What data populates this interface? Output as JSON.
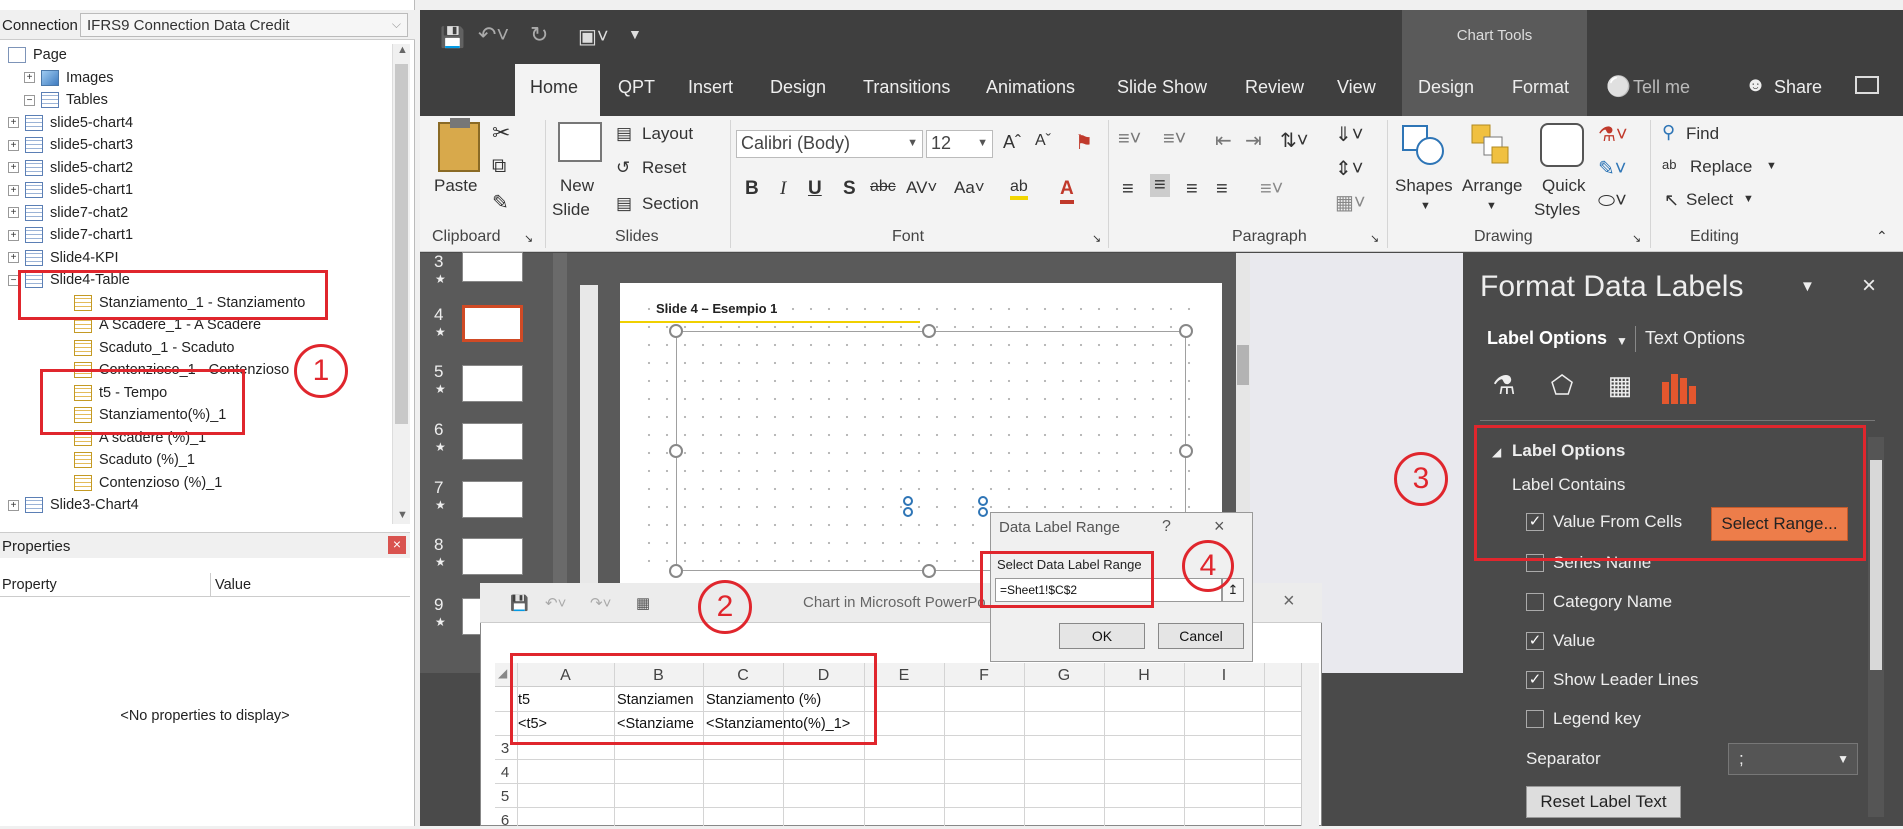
{
  "connection": {
    "label": "Connection",
    "value": "IFRS9 Connection Data Credit"
  },
  "tree": {
    "items": [
      {
        "label": "Page",
        "icon": "page-icon",
        "level": 1,
        "expander": ""
      },
      {
        "label": "Images",
        "icon": "images-icon",
        "level": 0,
        "expander": "+"
      },
      {
        "label": "Tables",
        "icon": "table-icon",
        "level": 0,
        "expander": "−"
      },
      {
        "label": "slide5-chart4",
        "icon": "table-icon",
        "level": 1,
        "expander": "+"
      },
      {
        "label": "slide5-chart3",
        "icon": "table-icon",
        "level": 1,
        "expander": "+"
      },
      {
        "label": "slide5-chart2",
        "icon": "table-icon",
        "level": 1,
        "expander": "+"
      },
      {
        "label": "slide5-chart1",
        "icon": "table-icon",
        "level": 1,
        "expander": "+"
      },
      {
        "label": "slide7-chat2",
        "icon": "table-icon",
        "level": 1,
        "expander": "+"
      },
      {
        "label": "slide7-chart1",
        "icon": "table-icon",
        "level": 1,
        "expander": "+"
      },
      {
        "label": "Slide4-KPI",
        "icon": "table-icon",
        "level": 1,
        "expander": "+"
      },
      {
        "label": "Slide4-Table",
        "icon": "table-icon",
        "level": 1,
        "expander": "−"
      },
      {
        "label": "Stanziamento_1 - Stanziamento",
        "icon": "field-icon",
        "level": 2,
        "expander": ""
      },
      {
        "label": "A Scadere_1 - A Scadere",
        "icon": "field-icon",
        "level": 2,
        "expander": ""
      },
      {
        "label": "Scaduto_1 - Scaduto",
        "icon": "field-icon",
        "level": 2,
        "expander": ""
      },
      {
        "label": "Contenzioso_1 - Contenzioso",
        "icon": "field-icon",
        "level": 2,
        "expander": ""
      },
      {
        "label": "t5 - Tempo",
        "icon": "field-icon",
        "level": 2,
        "expander": ""
      },
      {
        "label": "Stanziamento(%)_1",
        "icon": "field-icon",
        "level": 2,
        "expander": ""
      },
      {
        "label": "A scadere (%)_1",
        "icon": "field-icon",
        "level": 2,
        "expander": ""
      },
      {
        "label": "Scaduto (%)_1",
        "icon": "field-icon",
        "level": 2,
        "expander": ""
      },
      {
        "label": "Contenzioso (%)_1",
        "icon": "field-icon",
        "level": 2,
        "expander": ""
      },
      {
        "label": "Slide3-Chart4",
        "icon": "table-icon",
        "level": 1,
        "expander": "+"
      }
    ]
  },
  "properties": {
    "title": "Properties",
    "col_property": "Property",
    "col_value": "Value",
    "empty": "<No properties to display>"
  },
  "ribbon": {
    "context_label": "Chart Tools",
    "tabs": [
      "Home",
      "QPT",
      "Insert",
      "Design",
      "Transitions",
      "Animations",
      "Slide Show",
      "Review",
      "View",
      "Design",
      "Format"
    ],
    "tell_me": "Tell me",
    "share": "Share",
    "clipboard": {
      "paste": "Paste",
      "label": "Clipboard"
    },
    "slides": {
      "new_slide": "New",
      "new_slide2": "Slide",
      "layout": "Layout",
      "reset": "Reset",
      "section": "Section",
      "label": "Slides"
    },
    "font": {
      "name": "Calibri (Body)",
      "size": "12",
      "label": "Font"
    },
    "paragraph": {
      "label": "Paragraph"
    },
    "drawing": {
      "shapes": "Shapes",
      "arrange": "Arrange",
      "quick": "Quick",
      "styles": "Styles",
      "label": "Drawing"
    },
    "editing": {
      "find": "Find",
      "replace": "Replace",
      "select": "Select",
      "label": "Editing"
    }
  },
  "thumbnails": [
    "3",
    "4",
    "5",
    "6",
    "7",
    "8",
    "9"
  ],
  "slide": {
    "title": "Slide 4 – Esempio 1"
  },
  "format_pane": {
    "title": "Format Data Labels",
    "tab_label_options": "Label Options",
    "tab_text_options": "Text Options",
    "section": "Label Options",
    "contains": "Label Contains",
    "options": [
      {
        "label": "Value From Cells",
        "checked": true
      },
      {
        "label": "Series Name",
        "checked": false
      },
      {
        "label": "Category Name",
        "checked": false
      },
      {
        "label": "Value",
        "checked": true
      },
      {
        "label": "Show Leader Lines",
        "checked": true
      },
      {
        "label": "Legend key",
        "checked": false
      }
    ],
    "select_range": "Select Range...",
    "separator_label": "Separator",
    "separator_value": ";",
    "reset": "Reset Label Text"
  },
  "excel": {
    "title": "Chart in Microsoft PowerPo",
    "columns": [
      "A",
      "B",
      "C",
      "D",
      "E",
      "F",
      "G",
      "H",
      "I"
    ],
    "rows": [
      "",
      "",
      "3",
      "4",
      "5",
      "6"
    ],
    "cells": [
      [
        "t5",
        "Stanziamen",
        "Stanziamento (%)"
      ],
      [
        "<t5>",
        "<Stanziame",
        "<Stanziamento(%)_1>"
      ]
    ]
  },
  "dialog": {
    "title": "Data Label Range",
    "help": "?",
    "label": "Select Data Label Range",
    "value": "=Sheet1!$C$2",
    "ok": "OK",
    "cancel": "Cancel"
  },
  "callouts": [
    "1",
    "2",
    "3",
    "4"
  ],
  "colors": {
    "accent": "#ed7d4a",
    "highlight": "#e0262d",
    "dark_ui": "#4a4a4a"
  }
}
